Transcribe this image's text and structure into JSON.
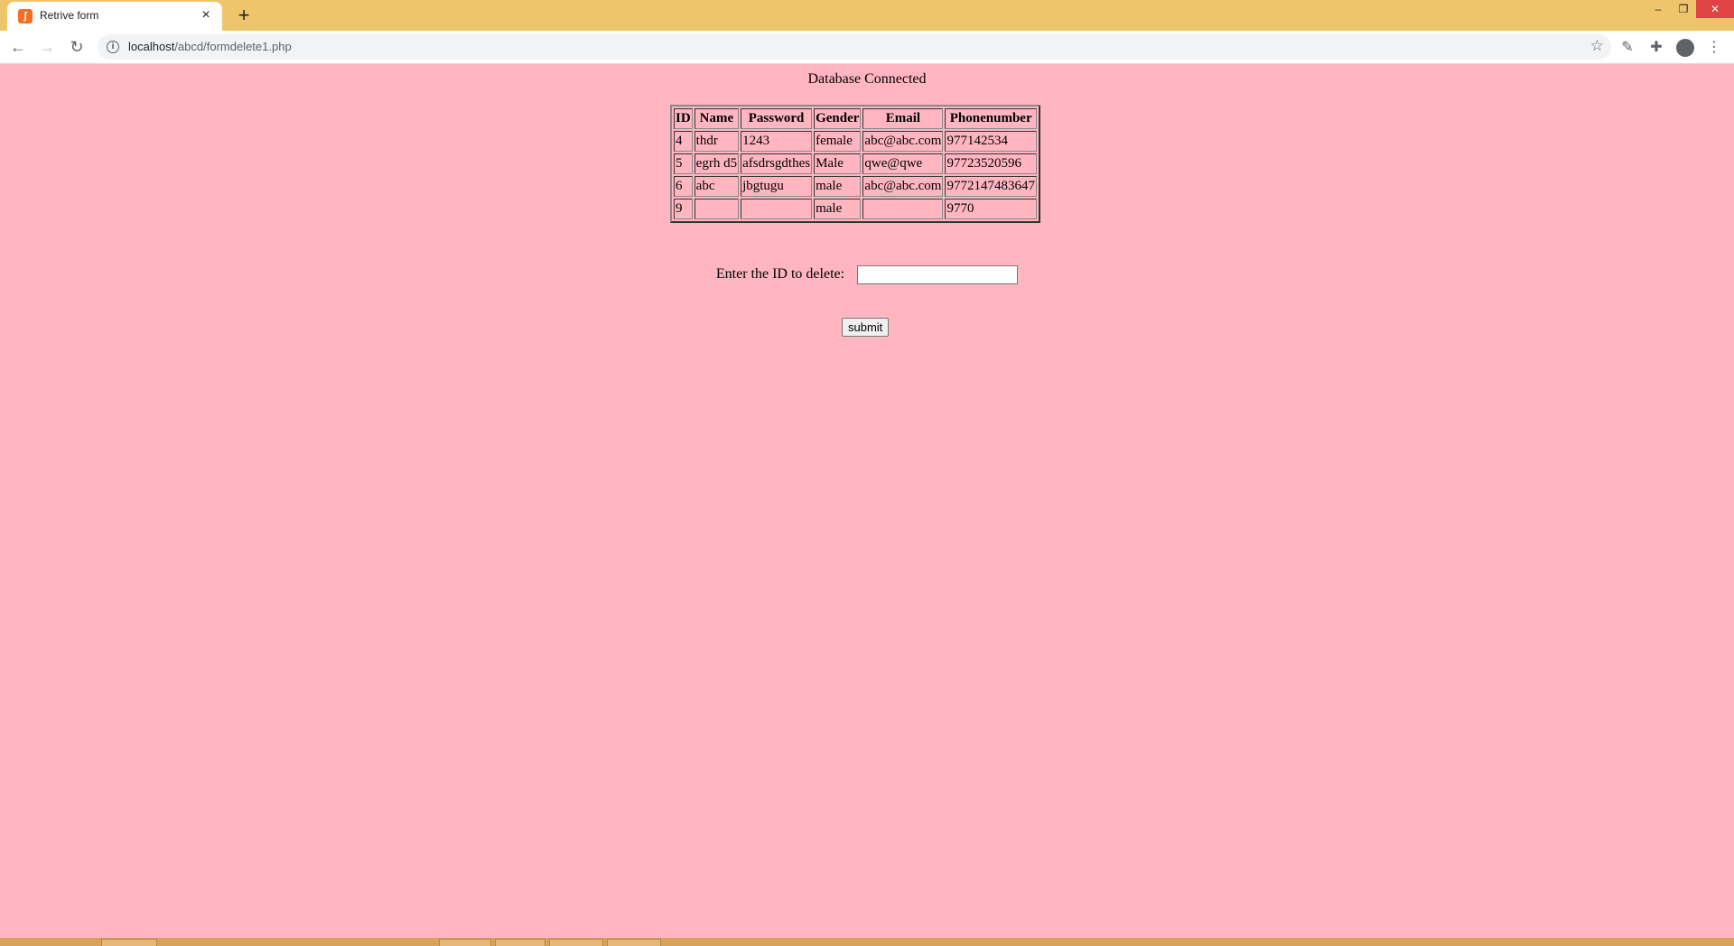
{
  "browser": {
    "tab_title": "Retrive form",
    "tab_close": "×",
    "new_tab": "+",
    "url_host": "localhost",
    "url_path": "/abcd/formdelete1.php",
    "icons": [
      "back-icon",
      "forward-icon",
      "reload-icon",
      "info-icon",
      "star-icon",
      "extensions-icon",
      "profile-icon",
      "menu-icon"
    ]
  },
  "page": {
    "status": "Database Connected",
    "table": {
      "headers": [
        "ID",
        "Name",
        "Password",
        "Gender",
        "Email",
        "Phonenumber"
      ],
      "rows": [
        [
          "4",
          "thdr",
          "1243",
          "female",
          "abc@abc.com",
          "977142534"
        ],
        [
          "5",
          "egrh d5",
          "afsdrsgdthes",
          "Male",
          "qwe@qwe",
          "97723520596"
        ],
        [
          "6",
          "abc",
          "jbgtugu",
          "male",
          "abc@abc.com",
          "9772147483647"
        ],
        [
          "9",
          "",
          "",
          "male",
          "",
          "9770"
        ]
      ]
    },
    "form": {
      "label": "Enter the ID to delete:",
      "input_value": "",
      "submit_label": "submit"
    }
  },
  "colors": {
    "page_background": "#ffb6c1",
    "tabstrip": "#efc56b"
  }
}
